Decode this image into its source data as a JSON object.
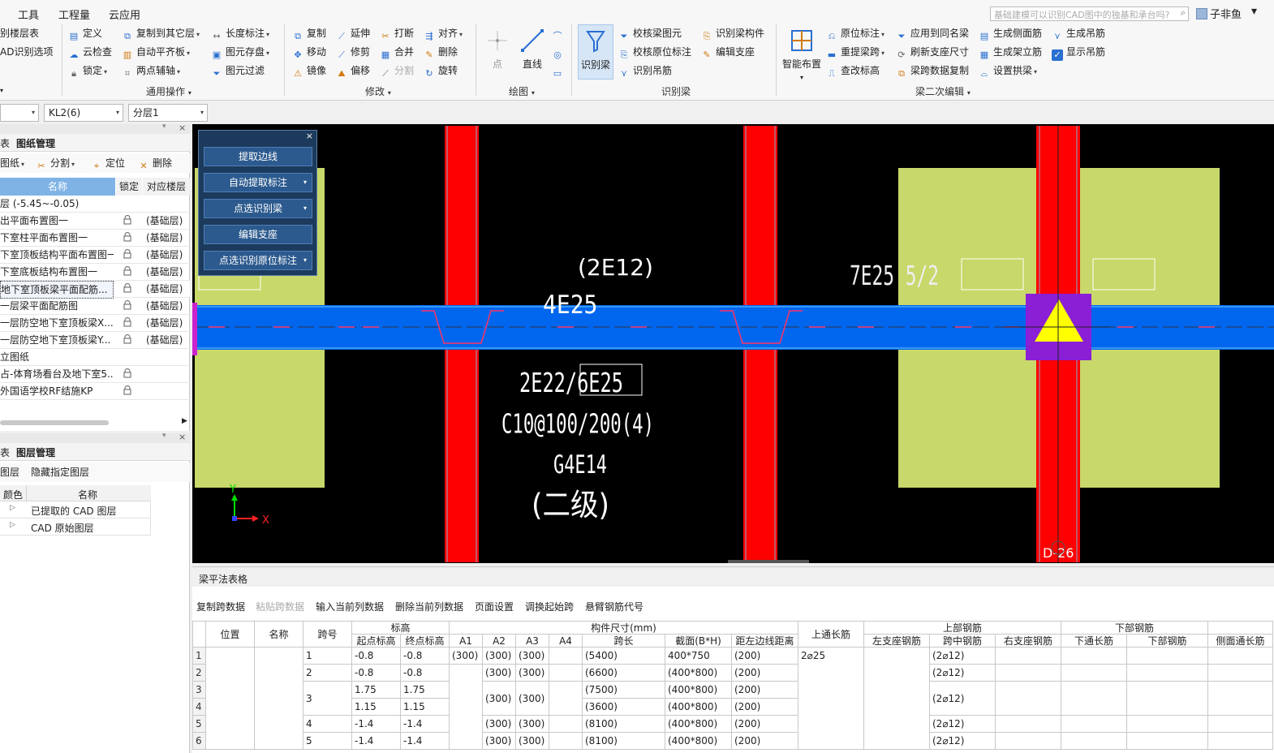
{
  "menubar": {
    "items": [
      "工具",
      "工程量",
      "云应用"
    ],
    "ai_search_placeholder": "基础建模可以识别CAD图中的独基和承台吗?",
    "user_name": "子非鱼"
  },
  "ribbon": {
    "cad": {
      "layer_table": "别楼层表",
      "cad_recognize": "AD识别选项"
    },
    "general": {
      "define": "定义",
      "copy_to_other": "复制到其它层",
      "length_mark": "长度标注",
      "cloud_check": "云检查",
      "auto_flat_slab": "自动平齐板",
      "elem_save": "图元存盘",
      "lock": "锁定",
      "two_point_axis": "两点辅轴",
      "elem_filter": "图元过滤",
      "label": "通用操作"
    },
    "modify": {
      "copy": "复制",
      "extend": "延伸",
      "break": "打断",
      "align": "对齐",
      "move": "移动",
      "trim": "修剪",
      "merge": "合并",
      "delete": "删除",
      "mirror": "镜像",
      "offset": "偏移",
      "split": "分割",
      "rotate": "旋转",
      "label": "修改"
    },
    "draw": {
      "point": "点",
      "line": "直线",
      "label": "绘图"
    },
    "recognize_beam": {
      "big": "识别梁",
      "check_beam": "校核梁图元",
      "check_orig_mark": "校核原位标注",
      "recognize_hanger": "识别吊筋",
      "recognize_beam_comp": "识别梁构件",
      "edit_support": "编辑支座",
      "label": "识别梁"
    },
    "beam_edit": {
      "smart_layout": "智能布置",
      "orig_mark": "原位标注",
      "reextract_span": "重提梁跨",
      "check_elev": "查改标高",
      "apply_same_beam": "应用到同名梁",
      "refresh_support": "刷新支座尺寸",
      "span_copy": "梁跨数据复制",
      "gen_side_rebar": "生成侧面筋",
      "gen_stirrup_column": "生成架立筋",
      "set_arch": "设置拱梁",
      "gen_hanger": "生成吊筋",
      "show_hanger": "显示吊筋",
      "label": "梁二次编辑"
    }
  },
  "combos": {
    "first": "",
    "component": "KL2(6)",
    "sublayer": "分层1"
  },
  "drawing_panel": {
    "tab_left": "表",
    "tab_active": "图纸管理",
    "tools": {
      "drawing": "图纸",
      "split": "分割",
      "locate": "定位",
      "delete": "删除"
    },
    "headers": {
      "name": "名称",
      "lock": "锁定",
      "floor": "对应楼层"
    },
    "rows": [
      {
        "name": "层 (-5.45~-0.05)",
        "floor": "",
        "locked": false
      },
      {
        "name": "出平面布置图一",
        "floor": "(基础层)",
        "locked": true
      },
      {
        "name": "下室柱平面布置图一",
        "floor": "(基础层)",
        "locked": true
      },
      {
        "name": "下室顶板结构平面布置图一",
        "floor": "(基础层)",
        "locked": true
      },
      {
        "name": "下室底板结构布置图一",
        "floor": "(基础层)",
        "locked": true
      },
      {
        "name": "地下室顶板梁平面配筋...",
        "floor": "(基础层)",
        "locked": true,
        "selected": true
      },
      {
        "name": "一层梁平面配筋图",
        "floor": "(基础层)",
        "locked": true
      },
      {
        "name": "一层防空地下室顶板梁X...",
        "floor": "(基础层)",
        "locked": true
      },
      {
        "name": "一层防空地下室顶板梁Y...",
        "floor": "(基础层)",
        "locked": true
      },
      {
        "name": "立图纸",
        "floor": "",
        "locked": false
      },
      {
        "name": "占-体育场看台及地下室5....",
        "floor": "",
        "locked": true
      },
      {
        "name": "外国语学校RF结施KP",
        "floor": "",
        "locked": true
      }
    ]
  },
  "layer_panel": {
    "tab_left": "表",
    "tab_active": "图层管理",
    "tools": {
      "show_layer": "图层",
      "hide_layer": "隐藏指定图层"
    },
    "headers": {
      "color": "颜色",
      "name": "名称"
    },
    "rows": [
      "已提取的 CAD 图层",
      "CAD 原始图层"
    ]
  },
  "float_menu": {
    "extract_edge": "提取边线",
    "auto_extract_mark": "自动提取标注",
    "point_recognize_beam": "点选识别梁",
    "edit_support": "编辑支座",
    "point_recognize_orig": "点选识别原位标注"
  },
  "canvas": {
    "texts": {
      "t1": "(2E12)",
      "t2": "4E25",
      "t3": "7E25 5/2",
      "t4": "2E22/6E25",
      "t5": "C10@100/200(4)",
      "t6": "G4E14",
      "t7": "(二级)",
      "axis_label": "D-26",
      "axis_x": "X",
      "axis_y": "Y"
    }
  },
  "table_panel": {
    "title": "梁平法表格",
    "tools": [
      "复制跨数据",
      "粘贴跨数据",
      "输入当前列数据",
      "删除当前列数据",
      "页面设置",
      "调换起始跨",
      "悬臂钢筋代号"
    ],
    "headers": {
      "position": "位置",
      "name": "名称",
      "span_no": "跨号",
      "elevation": "标高",
      "start_elev": "起点标高",
      "end_elev": "终点标高",
      "size_group": "构件尺寸(mm)",
      "a1": "A1",
      "a2": "A2",
      "a3": "A3",
      "a4": "A4",
      "span_len": "跨长",
      "section": "截面(B*H)",
      "dist_left": "距左边线距离",
      "top_through": "上通长筋",
      "top_group": "上部钢筋",
      "left_support": "左支座钢筋",
      "mid_span": "跨中钢筋",
      "right_support": "右支座钢筋",
      "bottom_group": "下部钢筋",
      "bottom_through": "下通长筋",
      "bottom_rebar": "下部钢筋",
      "side_through": "侧面通长筋"
    },
    "rows": [
      {
        "n": "1",
        "span": "1",
        "start": "-0.8",
        "end": "-0.8",
        "a1": "(300)",
        "a2": "(300)",
        "a3": "(300)",
        "len": "(5400)",
        "sec": "400*750",
        "dist": "(200)",
        "top": "2⌀25",
        "mid": "(2⌀12)"
      },
      {
        "n": "2",
        "span": "2",
        "start": "-0.8",
        "end": "-0.8",
        "a1": "",
        "a2": "(300)",
        "a3": "(300)",
        "len": "(6600)",
        "sec": "(400*800)",
        "dist": "(200)",
        "top": "",
        "mid": "(2⌀12)"
      },
      {
        "n": "3",
        "span": "3",
        "start": "1.75",
        "end": "1.75",
        "a1": "",
        "a2": "(300)",
        "a3": "(300)",
        "len": "(7500)",
        "sec": "(400*800)",
        "dist": "(200)",
        "top": "",
        "mid": "(2⌀12)"
      },
      {
        "n": "4",
        "span": "",
        "start": "1.15",
        "end": "1.15",
        "a1": "",
        "a2": "",
        "a3": "",
        "len": "(3600)",
        "sec": "(400*800)",
        "dist": "(200)",
        "top": "",
        "mid": ""
      },
      {
        "n": "5",
        "span": "4",
        "start": "-1.4",
        "end": "-1.4",
        "a1": "",
        "a2": "(300)",
        "a3": "(300)",
        "len": "(8100)",
        "sec": "(400*800)",
        "dist": "(200)",
        "top": "",
        "mid": "(2⌀12)"
      },
      {
        "n": "6",
        "span": "5",
        "start": "-1.4",
        "end": "-1.4",
        "a1": "",
        "a2": "(300)",
        "a3": "(300)",
        "len": "(8100)",
        "sec": "(400*800)",
        "dist": "(200)",
        "top": "",
        "mid": "(2⌀12)"
      }
    ]
  },
  "colors": {
    "canvas_bg": "#000000",
    "column_red": "#ff0000",
    "beam_blue": "#0066ee",
    "slab_green": "#c8d86a",
    "support_purple": "#8a1fd6",
    "support_yellow": "#ffff00"
  }
}
